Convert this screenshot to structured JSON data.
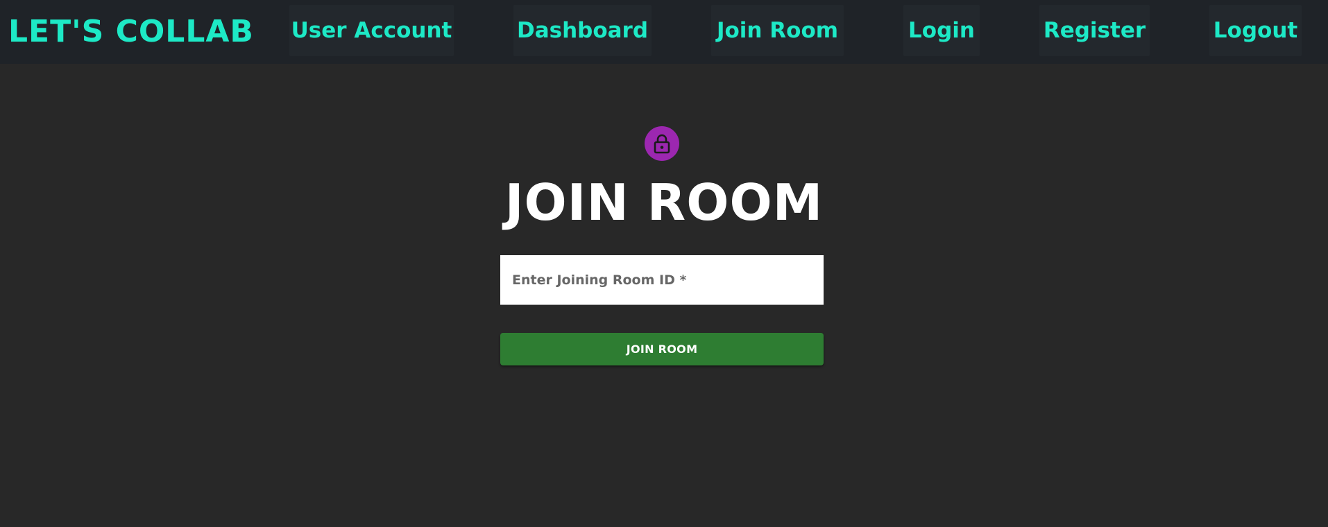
{
  "navbar": {
    "brand": "LET'S COLLAB",
    "items": [
      {
        "label": "User Account"
      },
      {
        "label": "Dashboard"
      },
      {
        "label": "Join Room"
      },
      {
        "label": "Login"
      },
      {
        "label": "Register"
      },
      {
        "label": "Logout"
      }
    ]
  },
  "main": {
    "icon": "lock-icon",
    "title": "JOIN ROOM",
    "room_input": {
      "value": "",
      "placeholder": "Enter Joining Room ID *"
    },
    "join_button_label": "JOIN ROOM"
  },
  "colors": {
    "background": "#282828",
    "navbar_background": "#1f2328",
    "nav_item_background": "#23282d",
    "accent": "#1de9c6",
    "lock_badge": "#9c27b0",
    "button": "#2e7d32",
    "title": "#ffffff"
  }
}
